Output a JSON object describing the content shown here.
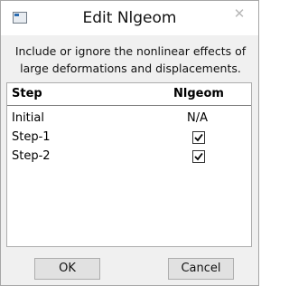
{
  "window": {
    "title": "Edit Nlgeom",
    "close_glyph": "✕"
  },
  "description": {
    "line1": "Include or ignore the nonlinear effects of",
    "line2": "large deformations and displacements."
  },
  "table": {
    "headers": {
      "step": "Step",
      "nlgeom": "Nlgeom"
    },
    "rows": [
      {
        "step": "Initial",
        "nlgeom_text": "N/A",
        "nlgeom_checked": null
      },
      {
        "step": "Step-1",
        "nlgeom_text": "",
        "nlgeom_checked": true
      },
      {
        "step": "Step-2",
        "nlgeom_text": "",
        "nlgeom_checked": true
      }
    ]
  },
  "buttons": {
    "ok": "OK",
    "cancel": "Cancel"
  }
}
